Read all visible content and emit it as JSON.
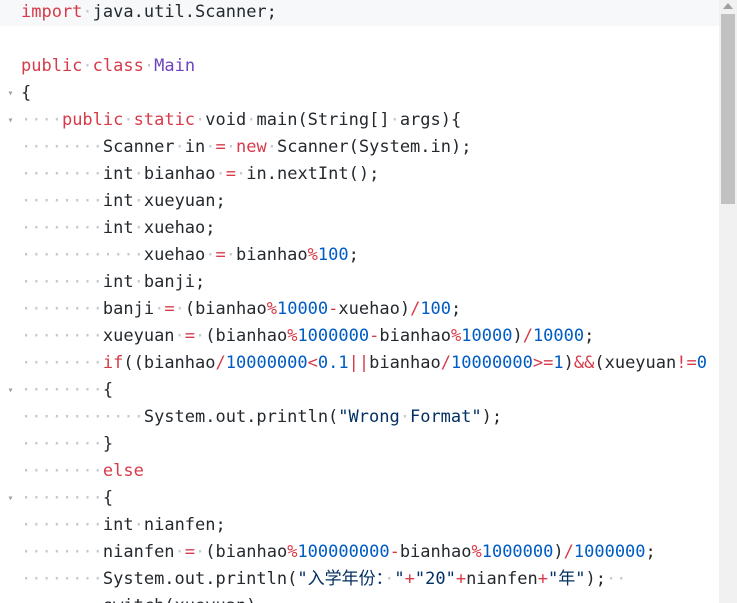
{
  "editor": {
    "lines": [
      {
        "fold": "",
        "tokens": [
          [
            "kw",
            "import"
          ],
          [
            "ws",
            "·"
          ],
          [
            "id",
            "java.util.Scanner;"
          ]
        ]
      },
      {
        "fold": "",
        "tokens": []
      },
      {
        "fold": "",
        "tokens": [
          [
            "kw",
            "public"
          ],
          [
            "ws",
            "·"
          ],
          [
            "kw",
            "class"
          ],
          [
            "ws",
            "·"
          ],
          [
            "cls",
            "Main"
          ]
        ]
      },
      {
        "fold": "▾",
        "tokens": [
          [
            "id",
            "{"
          ]
        ]
      },
      {
        "fold": "▾",
        "tokens": [
          [
            "ws",
            "····"
          ],
          [
            "kw",
            "public"
          ],
          [
            "ws",
            "·"
          ],
          [
            "kw",
            "static"
          ],
          [
            "ws",
            "·"
          ],
          [
            "id",
            "void"
          ],
          [
            "ws",
            "·"
          ],
          [
            "id",
            "main(String[]"
          ],
          [
            "ws",
            "·"
          ],
          [
            "id",
            "args){"
          ]
        ]
      },
      {
        "fold": "",
        "tokens": [
          [
            "ws",
            "········"
          ],
          [
            "id",
            "Scanner"
          ],
          [
            "ws",
            "·"
          ],
          [
            "id",
            "in"
          ],
          [
            "ws",
            "·"
          ],
          [
            "op",
            "="
          ],
          [
            "ws",
            "·"
          ],
          [
            "kw",
            "new"
          ],
          [
            "ws",
            "·"
          ],
          [
            "id",
            "Scanner(System.in);"
          ]
        ]
      },
      {
        "fold": "",
        "tokens": [
          [
            "ws",
            "········"
          ],
          [
            "id",
            "int"
          ],
          [
            "ws",
            "·"
          ],
          [
            "id",
            "bianhao"
          ],
          [
            "ws",
            "·"
          ],
          [
            "op",
            "="
          ],
          [
            "ws",
            "·"
          ],
          [
            "id",
            "in.nextInt();"
          ]
        ]
      },
      {
        "fold": "",
        "tokens": [
          [
            "ws",
            "········"
          ],
          [
            "id",
            "int"
          ],
          [
            "ws",
            "·"
          ],
          [
            "id",
            "xueyuan;"
          ]
        ]
      },
      {
        "fold": "",
        "tokens": [
          [
            "ws",
            "········"
          ],
          [
            "id",
            "int"
          ],
          [
            "ws",
            "·"
          ],
          [
            "id",
            "xuehao;"
          ]
        ]
      },
      {
        "fold": "",
        "tokens": [
          [
            "ws",
            "············"
          ],
          [
            "id",
            "xuehao"
          ],
          [
            "ws",
            "·"
          ],
          [
            "op",
            "="
          ],
          [
            "ws",
            "·"
          ],
          [
            "id",
            "bianhao"
          ],
          [
            "op",
            "%"
          ],
          [
            "num",
            "100"
          ],
          [
            "id",
            ";"
          ]
        ]
      },
      {
        "fold": "",
        "tokens": [
          [
            "ws",
            "········"
          ],
          [
            "id",
            "int"
          ],
          [
            "ws",
            "·"
          ],
          [
            "id",
            "banji;"
          ]
        ]
      },
      {
        "fold": "",
        "tokens": [
          [
            "ws",
            "········"
          ],
          [
            "id",
            "banji"
          ],
          [
            "ws",
            "·"
          ],
          [
            "op",
            "="
          ],
          [
            "ws",
            "·"
          ],
          [
            "id",
            "(bianhao"
          ],
          [
            "op",
            "%"
          ],
          [
            "num",
            "10000"
          ],
          [
            "op",
            "-"
          ],
          [
            "id",
            "xuehao)"
          ],
          [
            "op",
            "/"
          ],
          [
            "num",
            "100"
          ],
          [
            "id",
            ";"
          ]
        ]
      },
      {
        "fold": "",
        "tokens": [
          [
            "ws",
            "········"
          ],
          [
            "id",
            "xueyuan"
          ],
          [
            "ws",
            "·"
          ],
          [
            "op",
            "="
          ],
          [
            "ws",
            "·"
          ],
          [
            "id",
            "(bianhao"
          ],
          [
            "op",
            "%"
          ],
          [
            "num",
            "1000000"
          ],
          [
            "op",
            "-"
          ],
          [
            "id",
            "bianhao"
          ],
          [
            "op",
            "%"
          ],
          [
            "num",
            "10000"
          ],
          [
            "id",
            ")"
          ],
          [
            "op",
            "/"
          ],
          [
            "num",
            "10000"
          ],
          [
            "id",
            ";"
          ]
        ]
      },
      {
        "fold": "",
        "tokens": [
          [
            "ws",
            "········"
          ],
          [
            "kw",
            "if"
          ],
          [
            "id",
            "((bianhao"
          ],
          [
            "op",
            "/"
          ],
          [
            "num",
            "10000000"
          ],
          [
            "op",
            "<"
          ],
          [
            "num",
            "0.1"
          ],
          [
            "op",
            "||"
          ],
          [
            "id",
            "bianhao"
          ],
          [
            "op",
            "/"
          ],
          [
            "num",
            "10000000"
          ],
          [
            "op",
            ">="
          ],
          [
            "num",
            "1"
          ],
          [
            "id",
            ")"
          ],
          [
            "op",
            "&&"
          ],
          [
            "id",
            "(xueyuan"
          ],
          [
            "op",
            "!="
          ],
          [
            "num",
            "0"
          ]
        ]
      },
      {
        "fold": "▾",
        "tokens": [
          [
            "ws",
            "········"
          ],
          [
            "id",
            "{"
          ]
        ]
      },
      {
        "fold": "",
        "tokens": [
          [
            "ws",
            "············"
          ],
          [
            "id",
            "System.out.println("
          ],
          [
            "str",
            "\"Wrong"
          ],
          [
            "ws",
            "·"
          ],
          [
            "str",
            "Format\""
          ],
          [
            "id",
            ");"
          ]
        ]
      },
      {
        "fold": "",
        "tokens": [
          [
            "ws",
            "········"
          ],
          [
            "id",
            "}"
          ]
        ]
      },
      {
        "fold": "",
        "tokens": [
          [
            "ws",
            "········"
          ],
          [
            "kw",
            "else"
          ]
        ]
      },
      {
        "fold": "▾",
        "tokens": [
          [
            "ws",
            "········"
          ],
          [
            "id",
            "{"
          ]
        ]
      },
      {
        "fold": "",
        "tokens": [
          [
            "ws",
            "········"
          ],
          [
            "id",
            "int"
          ],
          [
            "ws",
            "·"
          ],
          [
            "id",
            "nianfen;"
          ]
        ]
      },
      {
        "fold": "",
        "tokens": [
          [
            "ws",
            "········"
          ],
          [
            "id",
            "nianfen"
          ],
          [
            "ws",
            "·"
          ],
          [
            "op",
            "="
          ],
          [
            "ws",
            "·"
          ],
          [
            "id",
            "(bianhao"
          ],
          [
            "op",
            "%"
          ],
          [
            "num",
            "100000000"
          ],
          [
            "op",
            "-"
          ],
          [
            "id",
            "bianhao"
          ],
          [
            "op",
            "%"
          ],
          [
            "num",
            "1000000"
          ],
          [
            "id",
            ")"
          ],
          [
            "op",
            "/"
          ],
          [
            "num",
            "1000000"
          ],
          [
            "id",
            ";"
          ]
        ]
      },
      {
        "fold": "",
        "tokens": [
          [
            "ws",
            "········"
          ],
          [
            "id",
            "System.out.println("
          ],
          [
            "str",
            "\"入学年份："
          ],
          [
            "ws",
            "·"
          ],
          [
            "str",
            "\""
          ],
          [
            "op",
            "+"
          ],
          [
            "str",
            "\"20\""
          ],
          [
            "op",
            "+"
          ],
          [
            "id",
            "nianfen"
          ],
          [
            "op",
            "+"
          ],
          [
            "str",
            "\"年\""
          ],
          [
            "id",
            ");"
          ],
          [
            "ws",
            "··"
          ]
        ]
      },
      {
        "fold": "",
        "tokens": [
          [
            "ws",
            "········"
          ],
          [
            "id",
            "switch(xueyuan)"
          ]
        ]
      }
    ]
  }
}
